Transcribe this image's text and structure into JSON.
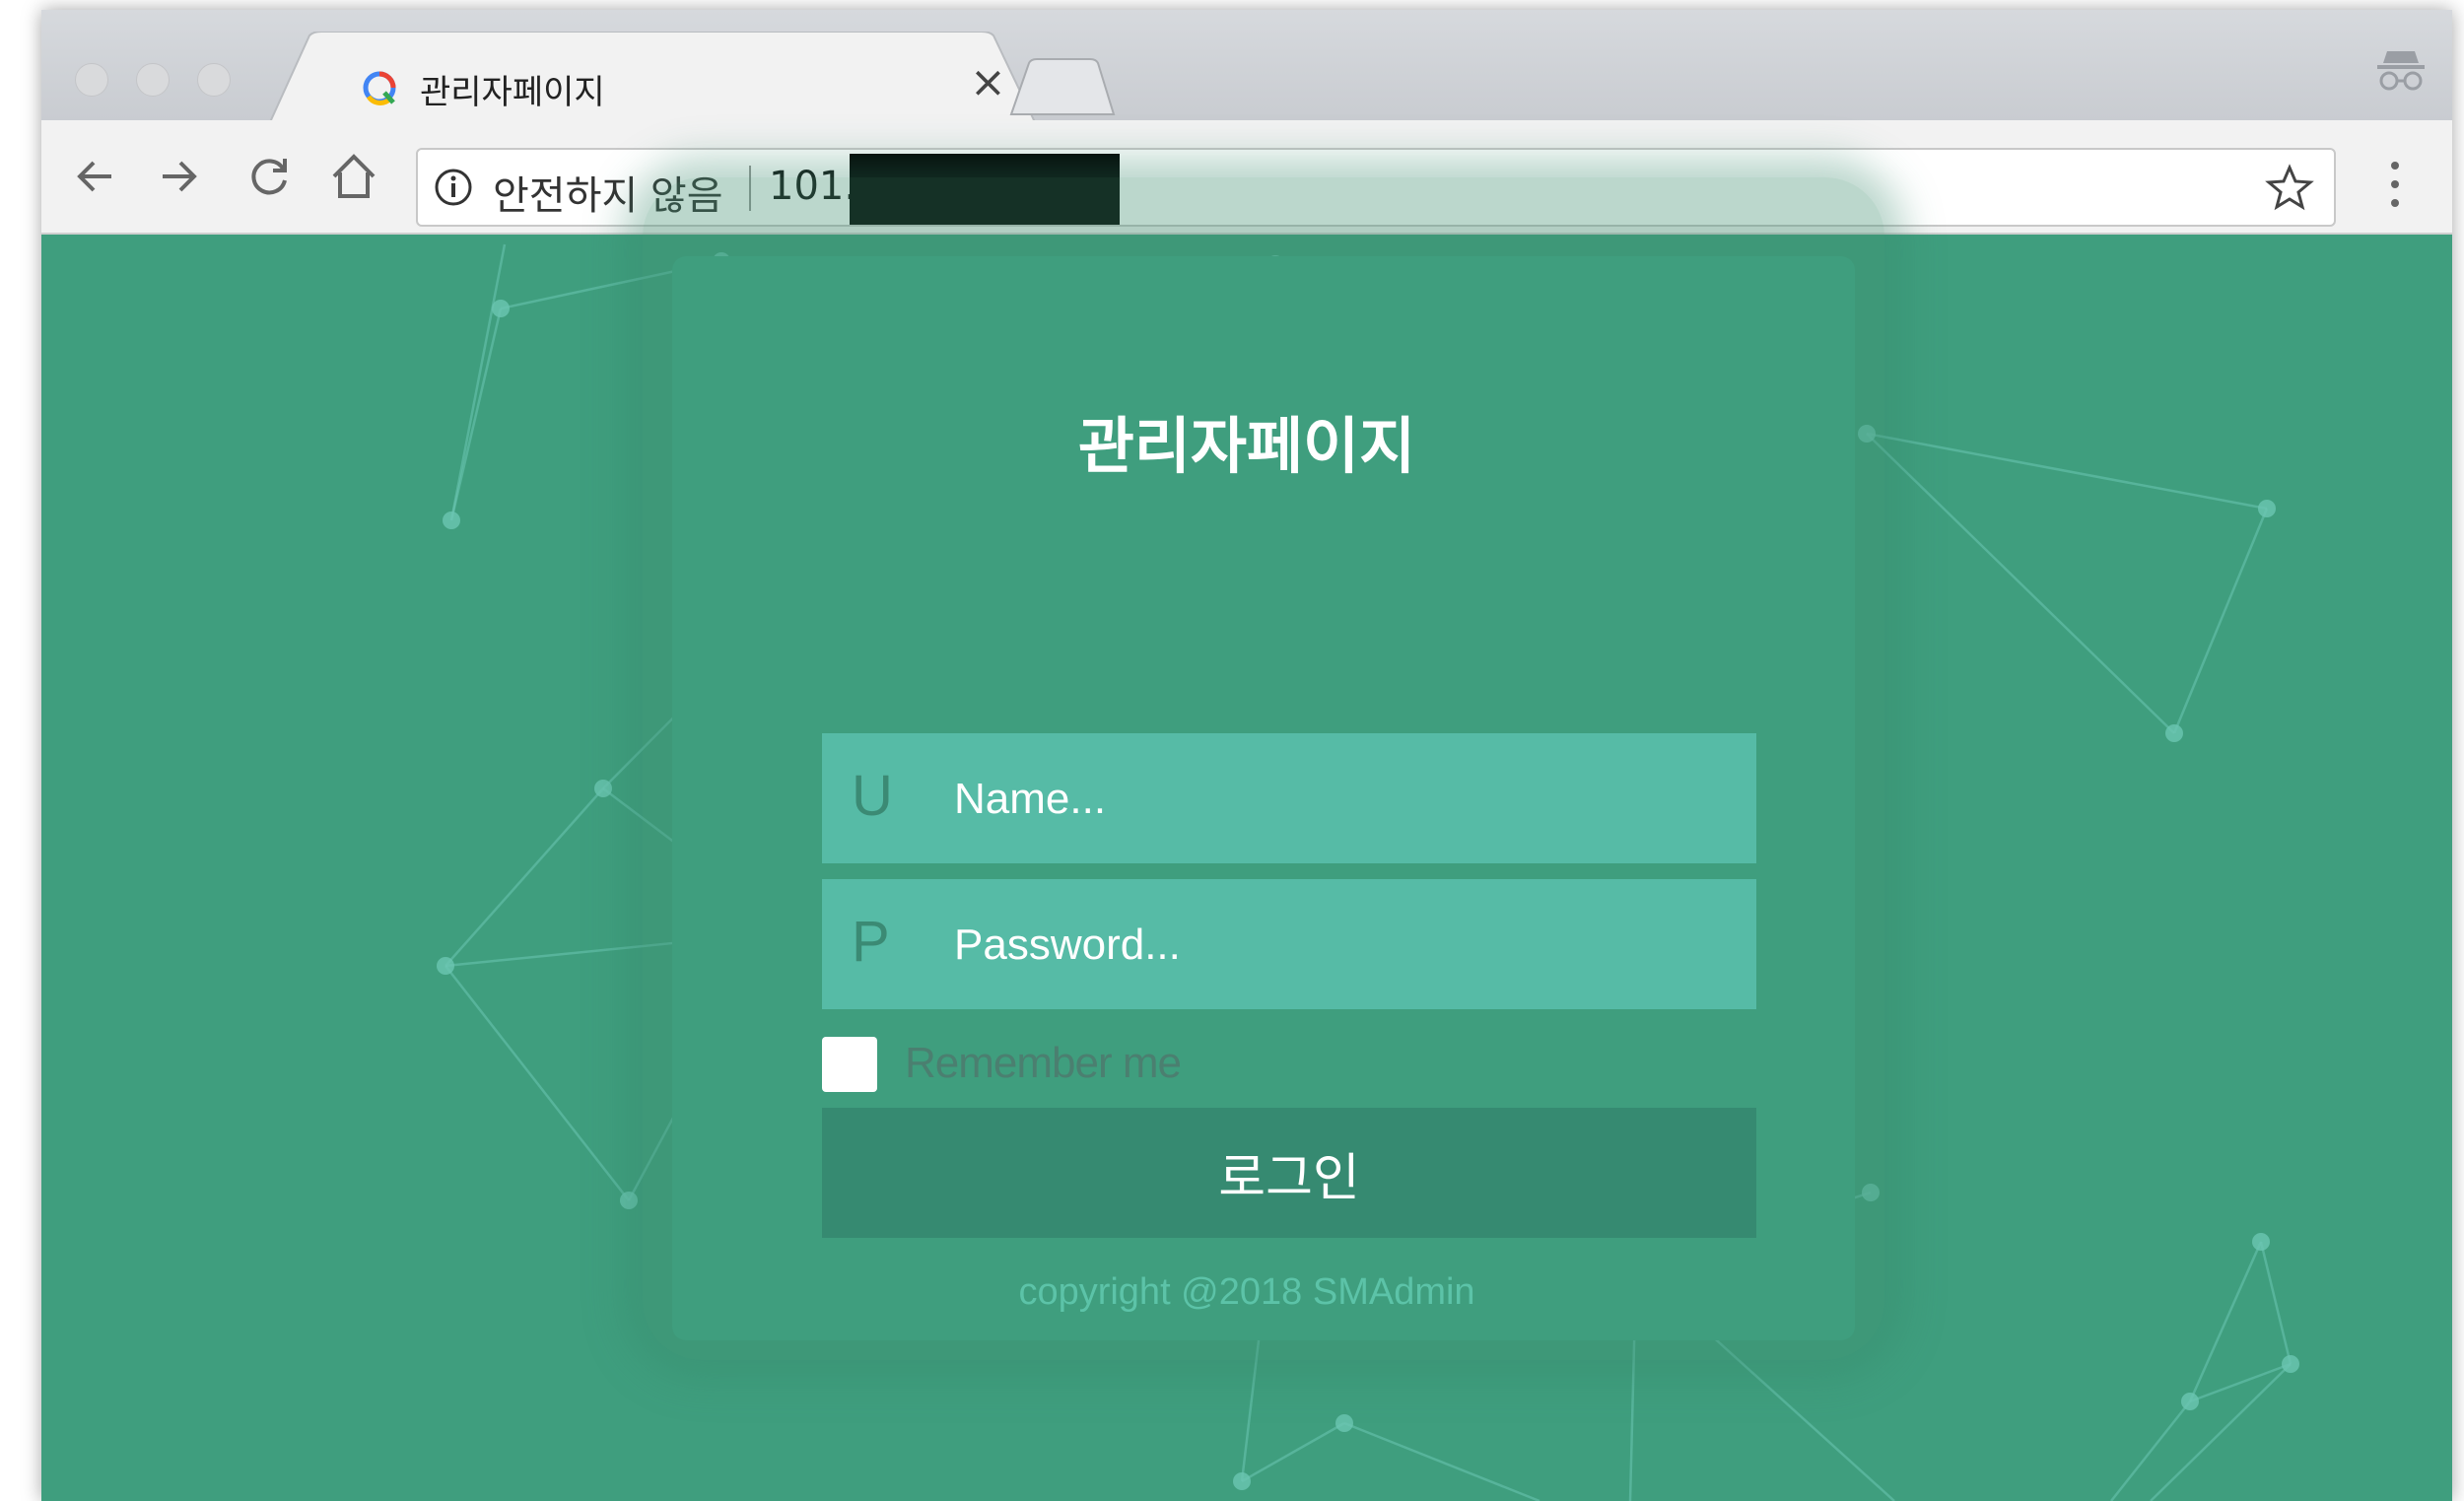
{
  "browser": {
    "tab": {
      "title": "관리자페이지",
      "close_glyph": "×"
    },
    "address_bar": {
      "security_label": "안전하지 않음",
      "url_visible": "101.",
      "url_redacted": true
    },
    "colors": {
      "page_bg": "#3f9e7e",
      "field_bg": "#56bba6",
      "button_bg": "#368a71"
    }
  },
  "login": {
    "title": "관리자페이지",
    "username": {
      "prefix": "U",
      "placeholder": "Name..."
    },
    "password": {
      "prefix": "P",
      "placeholder": "Password..."
    },
    "remember_label": "Remember me",
    "submit_label": "로그인",
    "copyright": "copyright @2018 SMAdmin"
  }
}
